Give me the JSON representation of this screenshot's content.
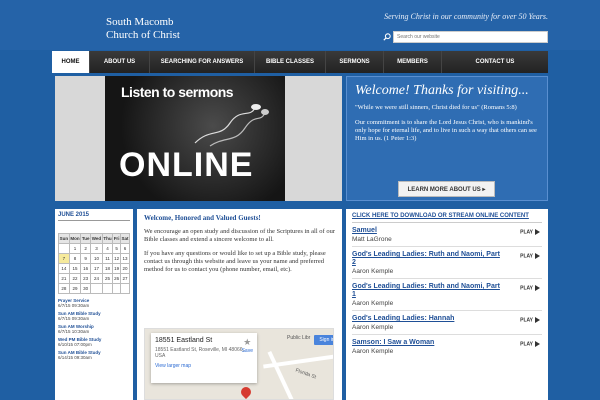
{
  "header": {
    "title_line1": "South Macomb",
    "title_line2": "Church of Christ",
    "tagline": "Serving Christ in our community for over 50 Years.",
    "search_placeholder": "Search our website"
  },
  "nav": {
    "items": [
      {
        "label": "HOME",
        "active": true
      },
      {
        "label": "ABOUT US"
      },
      {
        "label": "SEARCHING FOR ANSWERS"
      },
      {
        "label": "BIBLE CLASSES"
      },
      {
        "label": "SERMONS"
      },
      {
        "label": "MEMBERS"
      },
      {
        "label": "CONTACT US"
      }
    ]
  },
  "feature": {
    "listen": "Listen to sermons",
    "online": "ONLINE"
  },
  "welcome": {
    "title": "Welcome! Thanks for visiting...",
    "quote": "\"While we were still sinners, Christ died for us\" (Romans 5:8)",
    "body": "Our commitment is to share the Lord Jesus Christ, who is mankind's only hope for eternal life, and to live in such a way that others can see Him in us. (1 Peter 1:3)",
    "button": "LEARN MORE ABOUT US"
  },
  "calendar": {
    "title": "JUNE 2015",
    "days": [
      "Sun",
      "Mon",
      "Tue",
      "Wed",
      "Thu",
      "Fri",
      "Sat"
    ],
    "weeks": [
      [
        "",
        "1",
        "2",
        "3",
        "4",
        "5",
        "6"
      ],
      [
        "7",
        "8",
        "9",
        "10",
        "11",
        "12",
        "13"
      ],
      [
        "14",
        "15",
        "16",
        "17",
        "18",
        "19",
        "20"
      ],
      [
        "21",
        "22",
        "23",
        "24",
        "25",
        "26",
        "27"
      ],
      [
        "28",
        "29",
        "30",
        "",
        "",
        "",
        ""
      ]
    ],
    "highlight": "7",
    "events": [
      {
        "name": "Prayer Service",
        "time": "6/7/15 09:30am"
      },
      {
        "name": "Sun AM Bible Study",
        "time": "6/7/15 09:30am"
      },
      {
        "name": "Sun AM Worship",
        "time": "6/7/15 10:30am"
      },
      {
        "name": "Wed PM Bible Study",
        "time": "6/10/15 07:00pm"
      },
      {
        "name": "Sun AM Bible Study",
        "time": "6/14/15 09:30am"
      }
    ]
  },
  "middle": {
    "title": "Welcome, Honored and Valued Guests!",
    "p1": "We encourage an open study and discussion of the Scriptures in all of our Bible classes and extend a sincere welcome to all.",
    "p2": "If you have any questions or would like to set up a Bible study, please contact us through this website and leave us your name and preferred method for us to contact you (phone number, email, etc).",
    "map": {
      "address_title": "18551 Eastland St",
      "address_full": "18551 Eastland St, Roseville, MI 48066, USA",
      "larger_link": "View larger map",
      "save": "Save",
      "signin": "Sign in",
      "library": "Public Libr",
      "street": "Florida St"
    }
  },
  "sermons": {
    "title": "CLICK HERE TO DOWNLOAD OR STREAM ONLINE CONTENT",
    "play_label": "PLAY",
    "items": [
      {
        "title": "Samuel",
        "speaker": "Matt LaGrone"
      },
      {
        "title": "God's Leading Ladies: Ruth and Naomi, Part 2",
        "speaker": "Aaron Kemple"
      },
      {
        "title": "God's Leading Ladies: Ruth and Naomi, Part 1",
        "speaker": "Aaron Kemple"
      },
      {
        "title": "God's Leading Ladies: Hannah",
        "speaker": "Aaron Kemple"
      },
      {
        "title": "Samson: I Saw a Woman",
        "speaker": "Aaron Kemple"
      }
    ]
  }
}
